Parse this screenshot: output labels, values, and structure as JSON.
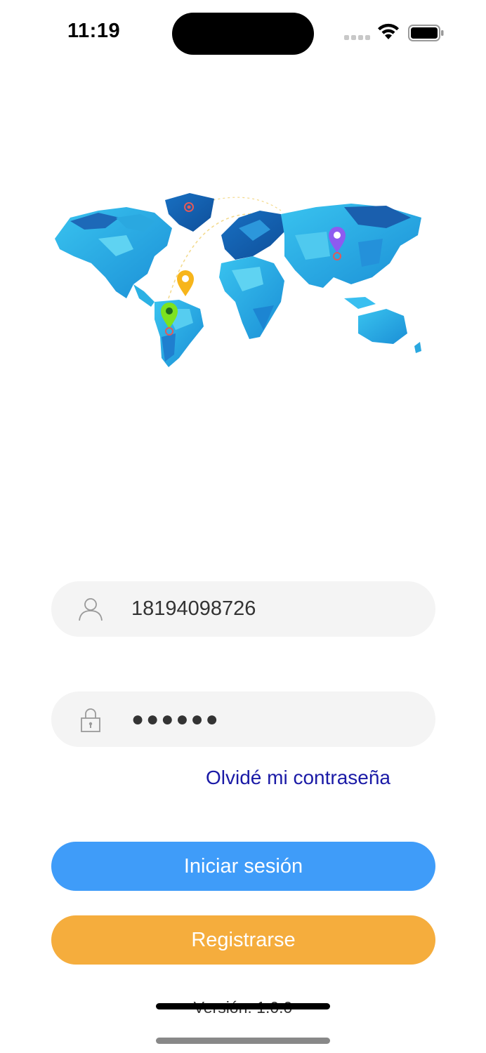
{
  "status_bar": {
    "time": "11:19",
    "icons": [
      "signal-dots-icon",
      "wifi-icon",
      "battery-icon"
    ]
  },
  "hero": {
    "image": "world-map-illustration",
    "pins": [
      "orange-pin-icon",
      "green-pin-icon",
      "purple-pin-icon",
      "red-pin-icon"
    ]
  },
  "login_form": {
    "username": {
      "icon": "user-icon",
      "value": "18194098726"
    },
    "password": {
      "icon": "lock-icon",
      "value": "●●●●●●"
    },
    "forgot_password": "Olvidé mi contraseña"
  },
  "actions": {
    "login_label": "Iniciar sesión",
    "register_label": "Registrarse"
  },
  "footer": {
    "version": "Versión: 1.0.0"
  },
  "colors": {
    "login_button": "#3f9cf9",
    "register_button": "#f5ad3d",
    "link": "#1a1aa6",
    "field_bg": "#f4f4f4",
    "map_light": "#29b6e6",
    "map_dark": "#1659a8"
  }
}
